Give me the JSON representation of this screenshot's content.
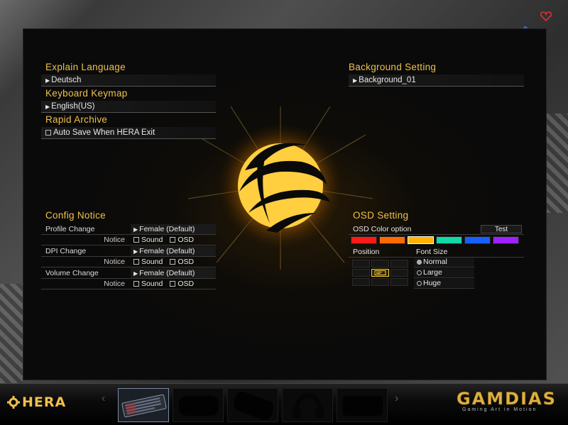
{
  "left": {
    "explain_language": {
      "title": "Explain Language",
      "value": "Deutsch"
    },
    "keyboard_keymap": {
      "title": "Keyboard Keymap",
      "value": "English(US)"
    },
    "rapid_archive": {
      "title": "Rapid Archive",
      "checkbox_label": "Auto Save When HERA Exit"
    }
  },
  "background": {
    "title": "Background Setting",
    "value": "Background_01"
  },
  "config_notice": {
    "title": "Config Notice",
    "rows": [
      {
        "label": "Profile Change",
        "voice": "Female (Default)",
        "notice": "Notice",
        "sound": "Sound",
        "osd": "OSD"
      },
      {
        "label": "DPI Change",
        "voice": "Female (Default)",
        "notice": "Notice",
        "sound": "Sound",
        "osd": "OSD"
      },
      {
        "label": "Volume Change",
        "voice": "Female (Default)",
        "notice": "Notice",
        "sound": "Sound",
        "osd": "OSD"
      }
    ]
  },
  "osd": {
    "title": "OSD Setting",
    "color_option_label": "OSD Color option",
    "test_button": "Test",
    "colors": [
      "#ff1a1a",
      "#ff6a00",
      "#ffb300",
      "#11d9a8",
      "#1560ff",
      "#a020ff"
    ],
    "position_label": "Position",
    "font_size_label": "Font Size",
    "font_sizes": [
      {
        "label": "Normal",
        "selected": true
      },
      {
        "label": "Large",
        "selected": false
      },
      {
        "label": "Huge",
        "selected": false
      }
    ]
  },
  "brand": {
    "product": "HERA",
    "company": "GAMDIAS",
    "tagline": "Gaming Art in Motion"
  }
}
